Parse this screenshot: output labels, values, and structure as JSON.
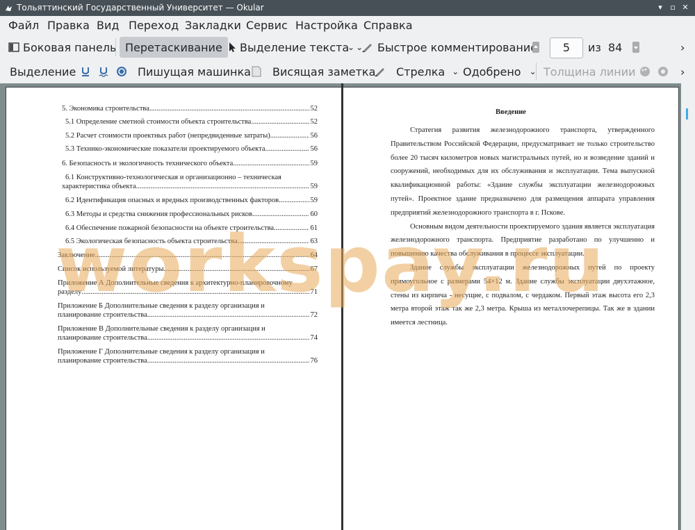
{
  "window": {
    "title": "Тольяттинский Государственный Университет  — Okular",
    "controls": {
      "minimize": "▾",
      "maximize": "▫",
      "close": "✕"
    }
  },
  "menu": [
    "Файл",
    "Правка",
    "Вид",
    "Переход",
    "Закладки",
    "Сервис",
    "Настройка",
    "Справка"
  ],
  "toolbar1": {
    "sidebar": "Боковая панель",
    "drag": "Перетаскивание",
    "text_select": "Выделение текста",
    "quick_annot": "Быстрое комментирование",
    "current_page": "5",
    "of_label": "из",
    "total_pages": "84",
    "more": "›"
  },
  "toolbar2": {
    "highlight": "Выделение",
    "typewriter": "Пишущая машинка",
    "popup_note": "Висящая заметка",
    "arrow": "Стрелка",
    "approved": "Одобрено",
    "line_width": "Толщина линии",
    "more": "›"
  },
  "left_page": {
    "toc": [
      {
        "text": "5. Экономика строительства",
        "page": "52"
      },
      {
        "text": "5.1 Определение сметной стоимости объекта строительства",
        "page": "52"
      },
      {
        "text": "5.2 Расчет стоимости проектных работ (непредвиденные затраты)",
        "page": "56"
      },
      {
        "text": "5.3 Технико-экономические показатели проектируемого объекта",
        "page": "56"
      },
      {
        "text": "6. Безопасность и экологичность технического объекта",
        "page": "59"
      },
      {
        "text": "6.1 Конструктивно-технологическая и организационно – техническая",
        "text2": "характеристика объекта",
        "page": "59"
      },
      {
        "text": "6.2 Идентификация опасных и вредных производственных факторов",
        "page": "59"
      },
      {
        "text": "6.3 Методы и средства снижения профессиональных рисков",
        "page": "60"
      },
      {
        "text": "6.4 Обеспечение пожарной безопасности на объекте строительства",
        "page": "61"
      },
      {
        "text": "6.5 Экологическая безопасность объекта строительства",
        "page": "63"
      },
      {
        "text": "Заключение",
        "page": "64"
      },
      {
        "text": "Список используемой литературы",
        "page": "67"
      },
      {
        "text": "Приложение А Дополнительные сведения к архитектурно-планировочному",
        "text2": "разделу",
        "page": "71"
      },
      {
        "text": "Приложение Б Дополнительные сведения к разделу организация и",
        "text2": "планирование строительства",
        "page": "72"
      },
      {
        "text": "Приложение В Дополнительные сведения к разделу организация и",
        "text2": "планирование строительства",
        "page": "74"
      },
      {
        "text": "Приложение Г Дополнительные сведения к разделу организация и",
        "text2": "планирование строительства",
        "page": "76"
      }
    ]
  },
  "right_page": {
    "title": "Введение",
    "paragraphs": [
      "Стратегия развития железнодорожного транспорта, утвержденного Правительством Российской Федерации, предусматривает не только строительство более 20 тысяч километров новых магистральных путей, но и возведение зданий и сооружений, необходимых для их обслуживания и эксплуатации. Тема выпускной квалификационной работы: «Здание службы эксплуатации железнодорожных путей». Проектное здание предназначено для размещения аппарата управления предприятий железнодорожного транспорта в г. Пскове.",
      "Основным видом деятельности проектируемого здания является эксплуатация железнодорожного транспорта. Предприятие разработано по улучшенно и повышению качества обслуживания в процессе эксплуатации.",
      "Здание службы эксплуатации железнодорожных путей по проекту прямоугольное с размерами 54×12 м. Здание службы эксплуатации двухэтажное, стены из кирпича - несущие, с подвалом, с чердаком. Первый этаж высота его 2,3 метра второй этаж так же 2,3 метра. Крыша из металлочерепицы. Так же в здании имеется лестница."
    ]
  },
  "watermark": "workspay.ru"
}
